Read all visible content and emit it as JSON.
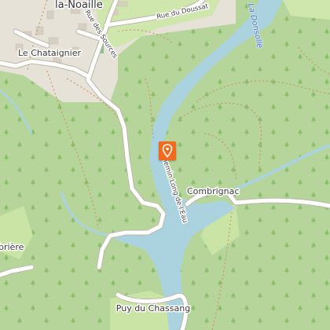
{
  "map": {
    "places": {
      "la_noaille": "la-Noaille",
      "le_chataignier": "Le Chataignier",
      "combrignac": "Combrignac",
      "puy_du_chassang": "Puy du Chassang",
      "briere": "brière"
    },
    "roads": {
      "rue_du_doussat": "Rue du Doussat",
      "rue_des_sources": "Rue des Sources",
      "chemin_long_de_leau": "Chemin Long de l'Eau"
    },
    "river": "La Donsolle",
    "marker": {
      "icon": "location-pin-icon",
      "color": "#f26a1b"
    },
    "colors": {
      "forest": "#b6d59a",
      "village": "#e7e2d8",
      "meadow": "#c9e4a5",
      "water": "#aad3df",
      "road": "#ffffff",
      "path": "#d2a679"
    }
  }
}
